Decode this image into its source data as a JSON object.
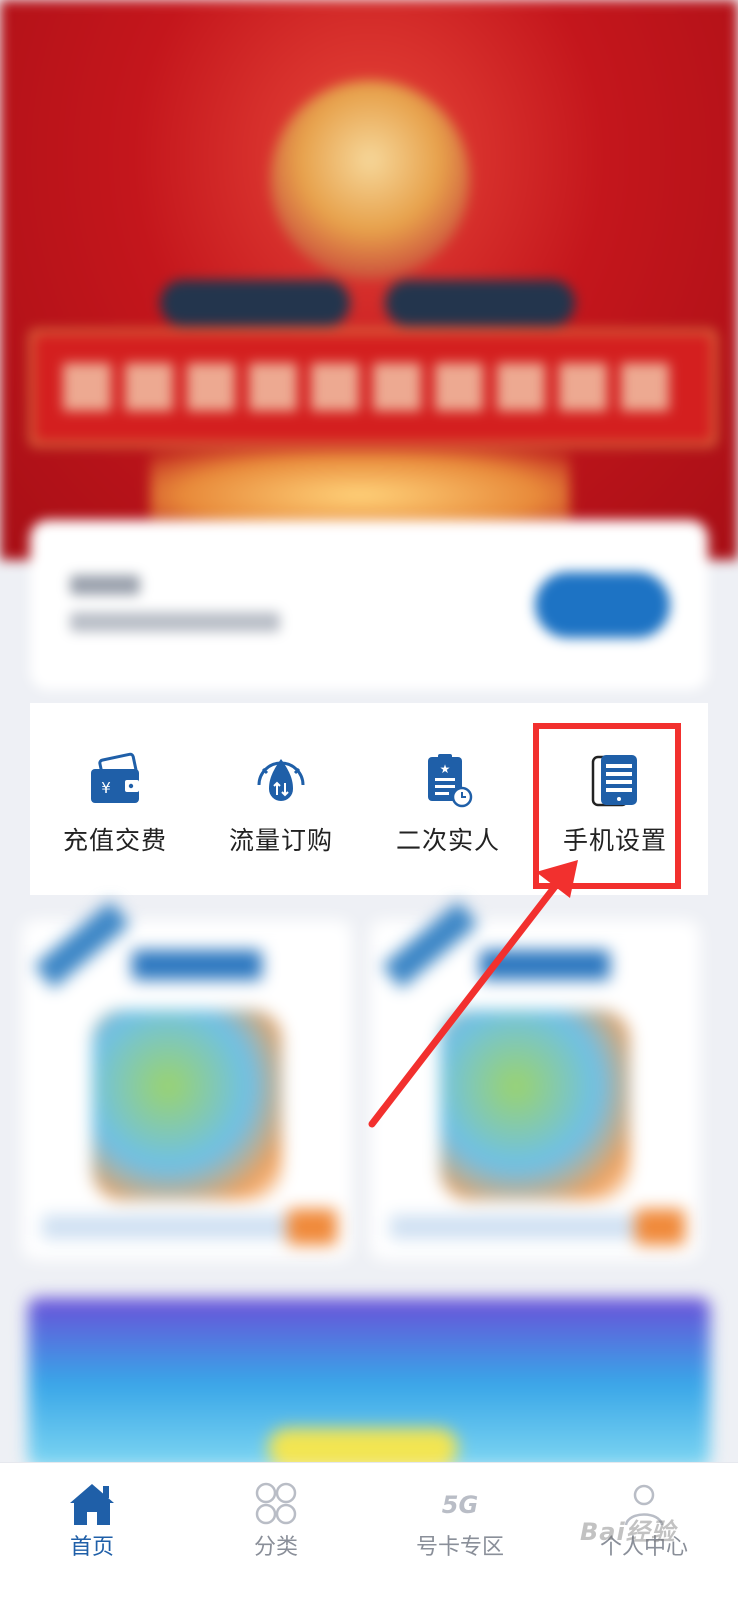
{
  "quick_actions": [
    {
      "label": "充值交费",
      "icon": "wallet-icon"
    },
    {
      "label": "流量订购",
      "icon": "data-gauge-icon"
    },
    {
      "label": "二次实人",
      "icon": "clipboard-id-icon"
    },
    {
      "label": "手机设置",
      "icon": "phone-settings-icon"
    }
  ],
  "tabbar": {
    "items": [
      {
        "label": "首页",
        "icon": "home-icon",
        "active": true
      },
      {
        "label": "分类",
        "icon": "grid-circles-icon",
        "active": false
      },
      {
        "label": "号卡专区",
        "icon": "5g-icon",
        "active": false
      },
      {
        "label": "个人中心",
        "icon": "user-icon",
        "active": false
      }
    ]
  },
  "watermark": {
    "text": "Bai经验"
  },
  "colors": {
    "accent_blue": "#1f5fa8",
    "annotation_red": "#f2302e",
    "banner_red": "#c4161c"
  }
}
